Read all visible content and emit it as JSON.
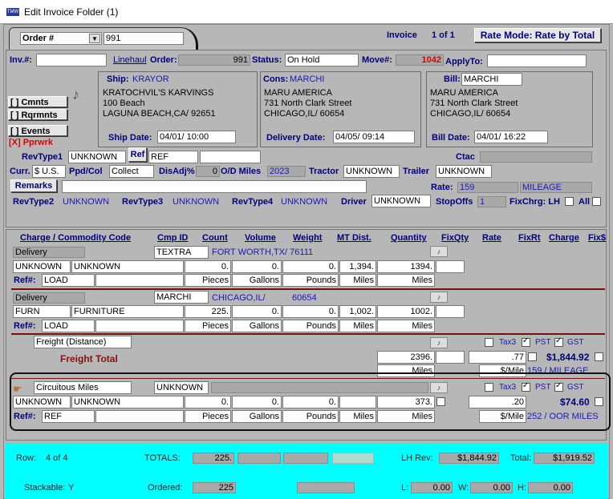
{
  "window": {
    "title": "Edit Invoice Folder (1)"
  },
  "header": {
    "order_type": "Order #",
    "order_number": "991",
    "invoice_label": "Invoice",
    "invoice_pos": "1 of 1",
    "rate_mode": "Rate Mode: Rate by Total"
  },
  "top": {
    "inv_label": "Inv.#:",
    "inv_value": "",
    "linehaul": "Linehaul",
    "order_label": "Order:",
    "order_value": "991",
    "status_label": "Status:",
    "status_value": "On Hold",
    "move_label": "Move#:",
    "move_value": "1042",
    "applyto_label": "ApplyTo:",
    "applyto_value": ""
  },
  "side_buttons": {
    "cmnts": "[ ] Cmnts",
    "rqrmnts": "[ ] Rqrmnts",
    "events": "[ ] Events",
    "pprwrk": "[X] Pprwrk"
  },
  "ship": {
    "label": "Ship:",
    "code": "KRAYOR",
    "name": "KRATOCHVIL'S KARVINGS",
    "addr1": "100 Beach",
    "addr2": "LAGUNA BEACH,CA/ 92651",
    "date_label": "Ship Date:",
    "date": "04/01/      10:00"
  },
  "cons": {
    "label": "Cons:",
    "code": "MARCHI",
    "name": "MARU AMERICA",
    "addr1": "731 North Clark Street",
    "addr2": "CHICAGO,IL/ 60654",
    "date_label": "Delivery Date:",
    "date": "04/05/      09:14"
  },
  "bill": {
    "label": "Bill:",
    "code": "MARCHI",
    "name": "MARU AMERICA",
    "addr1": "731 North Clark Street",
    "addr2": "CHICAGO,IL/ 60654",
    "date_label": "Bill Date:",
    "date": "04/01/      16:22"
  },
  "fields": {
    "revtype1_label": "RevType1",
    "revtype1": "UNKNOWN",
    "ref_btn": "Ref",
    "ref_value": "REF",
    "ctac_label": "Ctac",
    "curr_label": "Curr.",
    "curr": "$ U.S.",
    "ppdcol_label": "Ppd/Col",
    "ppdcol": "Collect",
    "disadj_label": "DisAdj%",
    "disadj": "0",
    "odmiles_label": "O/D Miles",
    "odmiles": "2023",
    "tractor_label": "Tractor",
    "tractor": "UNKNOWN",
    "trailer_label": "Trailer",
    "trailer": "UNKNOWN",
    "remarks_btn": "Remarks",
    "rate_label": "Rate:",
    "rate": "159",
    "rate_unit": "MILEAGE",
    "revtype2_label": "RevType2",
    "revtype2": "UNKNOWN",
    "revtype3_label": "RevType3",
    "revtype3": "UNKNOWN",
    "revtype4_label": "RevType4",
    "revtype4": "UNKNOWN",
    "driver_label": "Driver",
    "driver": "UNKNOWN",
    "stopoffs_label": "StopOffs",
    "stopoffs": "1",
    "fixchrg_label": "FixChrg: LH",
    "all_label": "All"
  },
  "grid_headers": [
    "Charge / Commodity Code",
    "Cmp ID",
    "Count",
    "Volume",
    "Weight",
    "MT Dist.",
    "Quantity",
    "FixQty",
    "Rate",
    "FixRt",
    "Charge",
    "Fix$"
  ],
  "stops": [
    {
      "event": "Delivery",
      "cmp": "TEXTRA",
      "city": "FORT WORTH,TX/ 76111",
      "zip": "",
      "code": "UNKNOWN",
      "desc": "UNKNOWN",
      "count": "0.",
      "volume": "0.",
      "weight": "0.",
      "dist": "1,394.",
      "qty": "1394.",
      "ref_label": "Ref#:",
      "ref": "LOAD",
      "u_count": "Pieces",
      "u_volume": "Gallons",
      "u_weight": "Pounds",
      "u_dist": "Miles",
      "u_qty": "Miles"
    },
    {
      "event": "Delivery",
      "cmp": "MARCHI",
      "city": "CHICAGO,IL/",
      "zip": "60654",
      "code": "FURN",
      "desc": "FURNITURE",
      "count": "225.",
      "volume": "0.",
      "weight": "0.",
      "dist": "1,002.",
      "qty": "1002.",
      "ref_label": "Ref#:",
      "ref": "LOAD",
      "u_count": "Pieces",
      "u_volume": "Gallons",
      "u_weight": "Pounds",
      "u_dist": "Miles",
      "u_qty": "Miles"
    }
  ],
  "freight": {
    "name": "Freight (Distance)",
    "total_label": "Freight Total",
    "qty": "2396.",
    "rate": ".77",
    "charge": "$1,844.92",
    "u_qty": "Miles",
    "u_rate": "$/Mile",
    "rate_desc": "159 / MILEAGE",
    "tax3": "Tax3",
    "pst": "PST",
    "gst": "GST"
  },
  "circuitous": {
    "name": "Circuitous Miles",
    "cmp": "UNKNOWN",
    "code": "UNKNOWN",
    "desc": "UNKNOWN",
    "count": "0.",
    "volume": "0.",
    "weight": "0.",
    "qty": "373.",
    "rate": ".20",
    "charge": "$74.60",
    "ref_label": "Ref#:",
    "ref": "REF",
    "u_count": "Pieces",
    "u_volume": "Gallons",
    "u_weight": "Pounds",
    "u_dist": "Miles",
    "u_qty": "Miles",
    "u_rate": "$/Mile",
    "rate_desc": "252 / OOR MILES",
    "tax3": "Tax3",
    "pst": "PST",
    "gst": "GST"
  },
  "footer": {
    "row_label": "Row:",
    "row_value": "4 of 4",
    "totals_label": "TOTALS:",
    "totals_count": "225.",
    "lhrev_label": "LH Rev:",
    "lhrev": "$1,844.92",
    "total_label": "Total:",
    "total": "$1,919.52",
    "stackable_label": "Stackable:",
    "stackable": "Y",
    "ordered_label": "Ordered:",
    "ordered": "225",
    "l_label": "L:",
    "l_val": "0.00",
    "w_label": "W:",
    "w_val": "0.00",
    "h_label": "H:",
    "h_val": "0.00"
  }
}
